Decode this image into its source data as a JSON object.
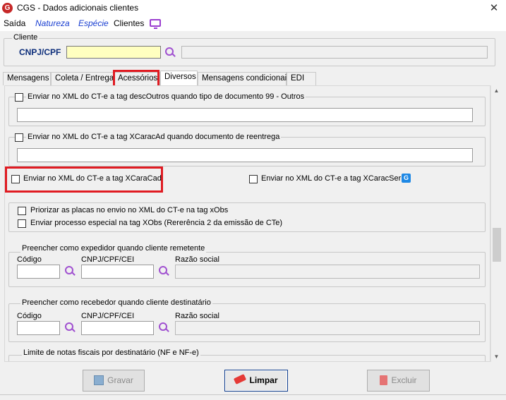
{
  "window": {
    "title": "CGS - Dados adicionais clientes",
    "close": "✕",
    "logo": "G"
  },
  "menu": {
    "items": [
      "Saída",
      "Natureza",
      "Espécie",
      "Clientes"
    ]
  },
  "cliente": {
    "group_label": "Cliente",
    "field_label": "CNPJ/CPF",
    "value": "",
    "name_value": ""
  },
  "tabs": [
    "Mensagens",
    "Coleta / Entrega",
    "Acessórios",
    "Diversos",
    "Mensagens condicionais",
    "EDI"
  ],
  "active_tab": "Diversos",
  "options": {
    "desc_outros": "Enviar no XML do CT-e a tag descOutros quando tipo de documento 99 - Outros",
    "xcaracad_reentrega": "Enviar no XML do CT-e a tag XCaracAd quando documento de reentrega",
    "xcaracad": "Enviar no XML do CT-e a tag XCaraCad",
    "xcaracser": "Enviar no XML do CT-e a tag XCaracSer",
    "priorizar_placas": "Priorizar as placas no envio no XML do CT-e na tag xObs",
    "processo_especial": "Enviar processo especial na tag XObs (Rererência 2 da emissão de CTe)"
  },
  "expedidor": {
    "group_label": "Preencher como expedidor quando cliente remetente",
    "codigo": "Código",
    "cnpj": "CNPJ/CPF/CEI",
    "razao": "Razão social"
  },
  "recebedor": {
    "group_label": "Preencher como recebedor quando cliente destinatário",
    "codigo": "Código",
    "cnpj": "CNPJ/CPF/CEI",
    "razao": "Razão social"
  },
  "limite": {
    "group_label": "Limite de notas fiscais por destinatário (NF e NF-e)"
  },
  "buttons": {
    "gravar": "Gravar",
    "limpar": "Limpar",
    "excluir": "Excluir"
  },
  "colors": {
    "highlight": "#e01b22",
    "accent": "#a050d0",
    "menu_blue": "#1a3fd1"
  },
  "icons": {
    "search": "magnifier-icon",
    "monitor": "monitor-icon",
    "save": "floppy-icon",
    "eraser": "eraser-icon",
    "trash": "trash-icon",
    "g_badge": "g-badge-icon"
  }
}
